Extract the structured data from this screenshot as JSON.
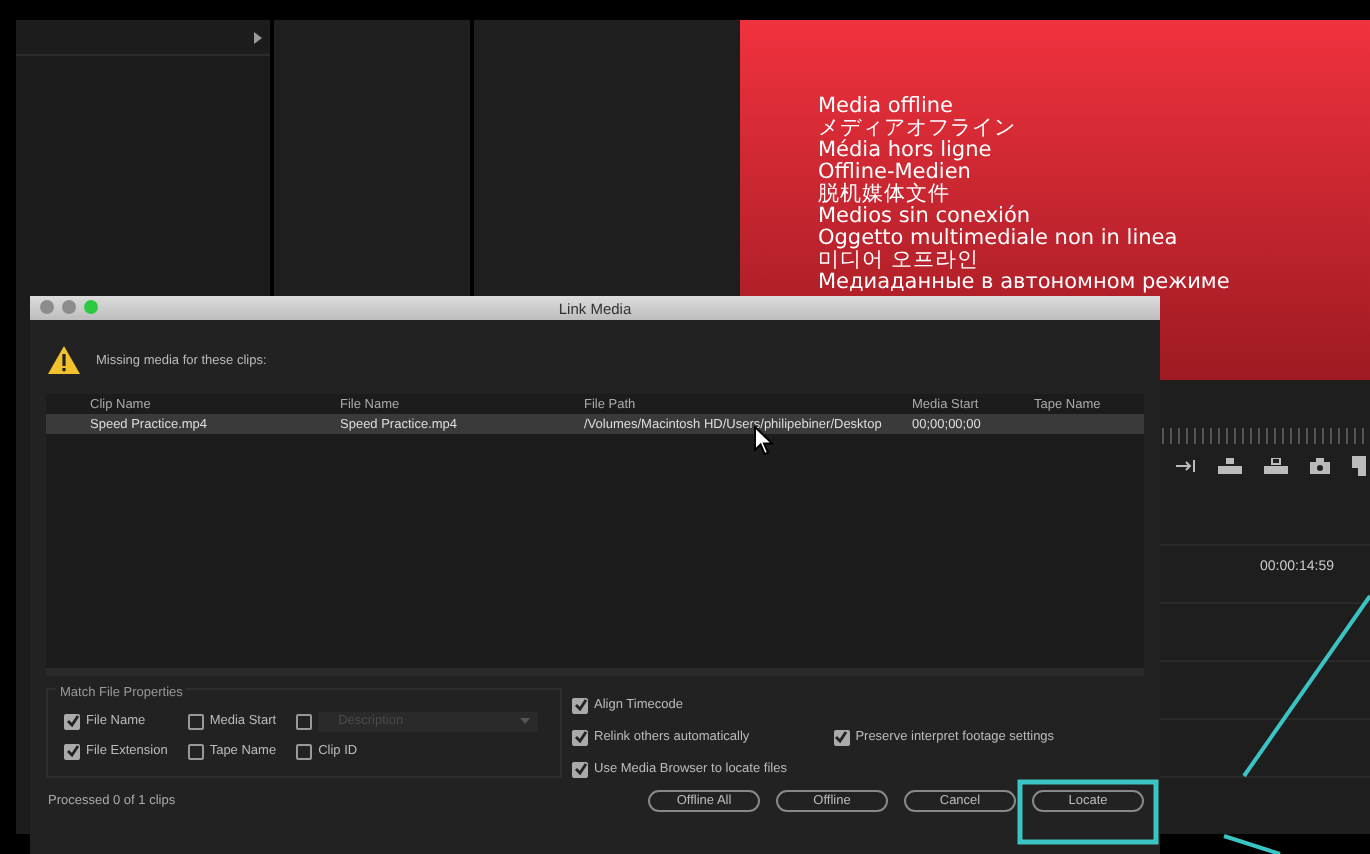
{
  "monitor": {
    "offline_lines": [
      "Media offline",
      "メディアオフライン",
      "Média hors ligne",
      "Offline-Medien",
      "脱机媒体文件",
      "Medios sin conexión",
      "Oggetto multimediale non in linea",
      "미디어 오프라인",
      "Медиаданные в автономном режиме"
    ]
  },
  "timeline": {
    "timecode": "00:00:14:59"
  },
  "dialog": {
    "title": "Link Media",
    "message": "Missing media for these clips:",
    "columns": [
      "Clip Name",
      "File Name",
      "File Path",
      "Media Start",
      "Tape Name"
    ],
    "rows": [
      {
        "cells": [
          "Speed Practice.mp4",
          "Speed Practice.mp4",
          "/Volumes/Macintosh HD/Users/philipebiner/Desktop",
          "00;00;00;00"
        ],
        "selected": true
      }
    ],
    "match_file_properties": {
      "title": "Match File Properties",
      "checkboxes": [
        {
          "label": "File Name",
          "checked": true
        },
        {
          "label": "Media Start",
          "checked": false
        },
        {
          "label": "Description",
          "checked": false,
          "kind": "dropdown",
          "disabled": true
        },
        {
          "label": "File Extension",
          "checked": true
        },
        {
          "label": "Tape Name",
          "checked": false
        },
        {
          "label": "Clip ID",
          "checked": false
        }
      ]
    },
    "options": [
      {
        "label": "Align Timecode",
        "checked": true
      },
      {
        "label": "Relink others automatically",
        "checked": true
      },
      {
        "label": "Preserve interpret footage settings",
        "checked": true
      },
      {
        "label": "Use Media Browser to locate files",
        "checked": true
      }
    ],
    "status": "Processed 0 of 1 clips",
    "buttons": [
      "Offline All",
      "Offline",
      "Cancel",
      "Locate"
    ]
  }
}
